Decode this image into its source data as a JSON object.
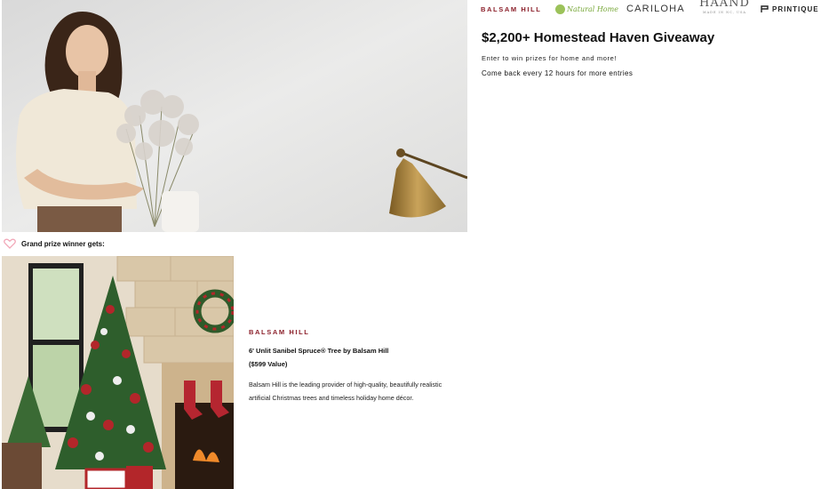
{
  "logos": {
    "balsam_hill": "BALSAM HILL",
    "natural_home": "Natural Home",
    "cariloha": "CARILOHA",
    "haand": "HAAND",
    "haand_tagline": "MADE IN NC, USA",
    "printique": "PRINTIQUE"
  },
  "giveaway": {
    "title": "$2,200+ Homestead Haven Giveaway",
    "subtitle": "Enter to win prizes for home and more!",
    "return_note": "Come back every 12 hours for more entries"
  },
  "grand_prize": {
    "label": "Grand prize winner gets:",
    "icon": "heart-icon"
  },
  "prize": {
    "brand": "BALSAM HILL",
    "name": "6' Unlit Sanibel Spruce® Tree by Balsam Hill",
    "value": "($599 Value)",
    "description": "Balsam Hill is the leading provider of high-quality, beautifully realistic artificial Christmas trees and timeless holiday home décor."
  },
  "colors": {
    "brand_red": "#8b1f2a",
    "natural_green": "#78a83a",
    "text": "#111111"
  }
}
